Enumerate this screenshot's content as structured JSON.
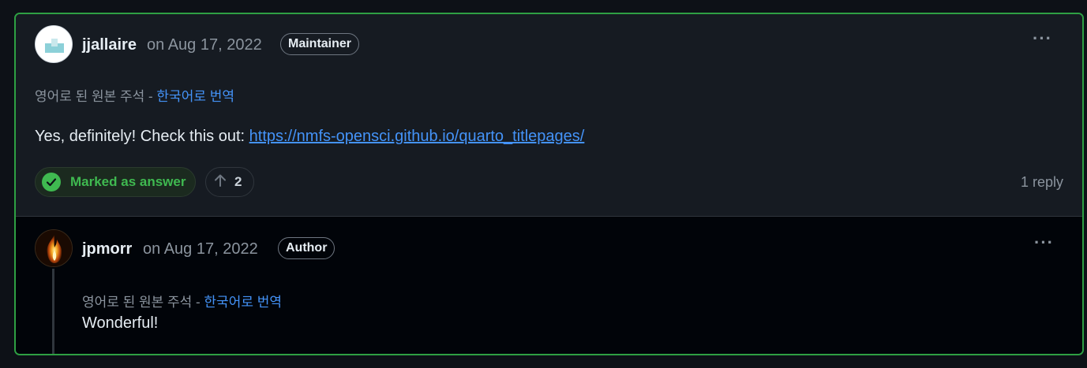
{
  "comment": {
    "author": "jjallaire",
    "date": "on Aug 17, 2022",
    "badge": "Maintainer",
    "translation_note": "영어로 된 원본 주석 -",
    "translation_link": "한국어로 번역",
    "body_prefix": "Yes, definitely! Check this out:",
    "body_link": "https://nmfs-opensci.github.io/quarto_titlepages/",
    "answer_label": "Marked as answer",
    "upvotes": "2",
    "reply_count": "1 reply",
    "menu_glyph": "···"
  },
  "reply": {
    "author": "jpmorr",
    "date": "on Aug 17, 2022",
    "badge": "Author",
    "translation_note": "영어로 된 원본 주석 -",
    "translation_link": "한국어로 번역",
    "body": "Wonderful!",
    "menu_glyph": "···"
  },
  "colors": {
    "accepted_border": "#2ea043",
    "answer_green": "#3fb950",
    "link_blue": "#4493f8",
    "card_bg": "#161b22",
    "reply_bg": "#010409"
  },
  "icons": [
    "check-circle-icon",
    "arrow-up-icon",
    "kebab-menu-icon",
    "avatar-image"
  ]
}
